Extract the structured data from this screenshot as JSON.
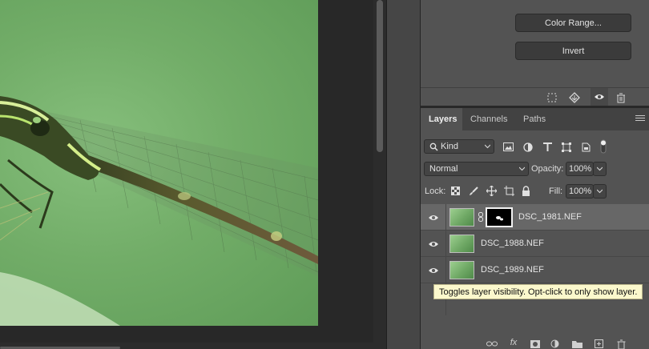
{
  "properties_panel": {
    "color_range_label": "Color Range...",
    "invert_label": "Invert",
    "footer_icons": [
      "load-selection-icon",
      "apply-mask-icon",
      "visibility-eye-icon",
      "delete-icon"
    ]
  },
  "layers_panel": {
    "tabs": [
      {
        "label": "Layers",
        "active": true
      },
      {
        "label": "Channels",
        "active": false
      },
      {
        "label": "Paths",
        "active": false
      }
    ],
    "filter": {
      "kind_label": "Kind",
      "filter_icons": [
        "pixel-filter-icon",
        "adjustment-filter-icon",
        "type-filter-icon",
        "shape-filter-icon",
        "smart-object-filter-icon",
        "filter-toggle-icon"
      ]
    },
    "blend_mode": "Normal",
    "opacity_label": "Opacity:",
    "opacity_value": "100%",
    "lock_label": "Lock:",
    "lock_icons": [
      "lock-transparent-pixels-icon",
      "lock-image-pixels-icon",
      "lock-position-icon",
      "lock-artboard-icon",
      "lock-all-icon"
    ],
    "fill_label": "Fill:",
    "fill_value": "100%",
    "layers": [
      {
        "name": "DSC_1981.NEF",
        "visible": true,
        "selected": true,
        "has_mask": true
      },
      {
        "name": "DSC_1988.NEF",
        "visible": true,
        "selected": false,
        "has_mask": false
      },
      {
        "name": "DSC_1989.NEF",
        "visible": true,
        "selected": false,
        "has_mask": false
      }
    ],
    "tooltip": "Toggles layer visibility. Opt-click to only show layer.",
    "footer_icons": [
      "link-layers-icon",
      "fx-icon",
      "add-mask-icon",
      "new-adjustment-icon",
      "new-group-icon",
      "new-layer-icon",
      "delete-layer-icon"
    ],
    "fx_label": "fx"
  },
  "colors": {
    "panel_bg": "#535353",
    "selected_row": "#676767",
    "tooltip_bg": "#fbf8cc"
  }
}
